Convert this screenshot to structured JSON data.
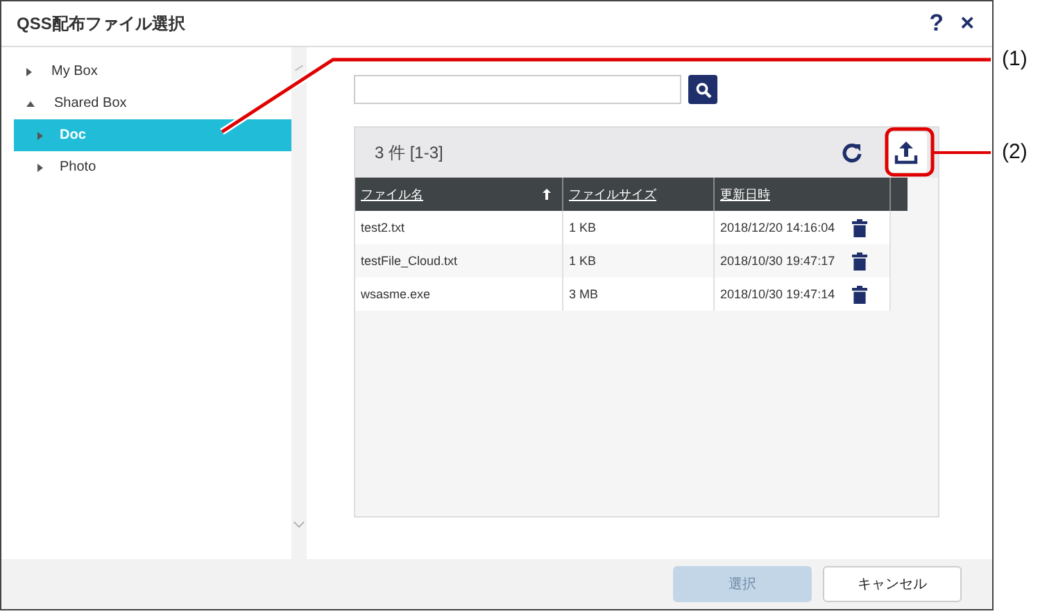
{
  "dialog": {
    "title": "QSS配布ファイル選択",
    "help": "?",
    "close": "×"
  },
  "tree": [
    {
      "label": "My Box",
      "expanded": false,
      "selected": false
    },
    {
      "label": "Shared Box",
      "expanded": true,
      "selected": false,
      "children": [
        {
          "label": "Doc",
          "expanded": false,
          "selected": true
        },
        {
          "label": "Photo",
          "expanded": false,
          "selected": false
        }
      ]
    }
  ],
  "results": {
    "count": "3 件  [1-3]"
  },
  "table": {
    "columns": [
      {
        "label": "ファイル名",
        "sorted": true
      },
      {
        "label": "ファイルサイズ",
        "sorted": false
      },
      {
        "label": "更新日時",
        "sorted": false
      }
    ],
    "rows": [
      {
        "name": "test2.txt",
        "size": "1 KB",
        "date": "2018/12/20 14:16:04"
      },
      {
        "name": "testFile_Cloud.txt",
        "size": "1 KB",
        "date": "2018/10/30 19:47:17"
      },
      {
        "name": "wsasme.exe",
        "size": "3 MB",
        "date": "2018/10/30 19:47:14"
      }
    ]
  },
  "buttons": [
    {
      "label": "選択",
      "disabled": true
    },
    {
      "label": "キャンセル",
      "disabled": false
    }
  ],
  "callouts": [
    "(1)",
    "(2)"
  ]
}
